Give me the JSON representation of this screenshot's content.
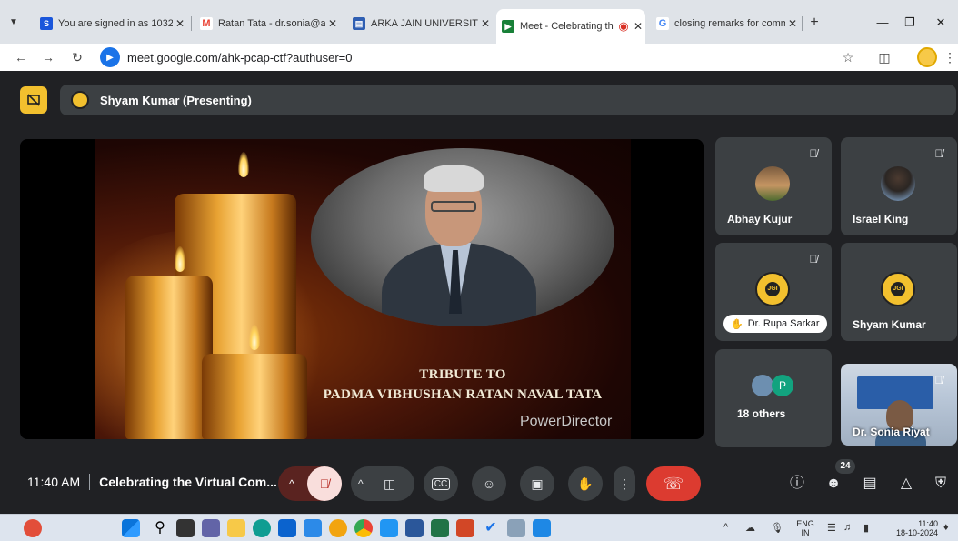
{
  "browser": {
    "tabs": [
      {
        "title": "You are signed in as 1032",
        "favicon": "S",
        "color": "#1a56db"
      },
      {
        "title": "Ratan Tata - dr.sonia@ar",
        "favicon": "M",
        "color": "#ea4335"
      },
      {
        "title": "ARKA JAIN UNIVERSITY -",
        "favicon": "▤",
        "color": "#2f5fb3"
      },
      {
        "title": "Meet - Celebrating th",
        "favicon": "▶",
        "color": "#188038"
      },
      {
        "title": "closing remarks for comm",
        "favicon": "G",
        "color": "#4285f4"
      }
    ],
    "url": "meet.google.com/ahk-pcap-ctf?authuser=0"
  },
  "meet": {
    "presenter_banner": "Shyam Kumar (Presenting)",
    "slide": {
      "line1": "TRIBUTE TO",
      "line2": "PADMA VIBHUSHAN RATAN NAVAL TATA",
      "watermark": "PowerDirector"
    },
    "participants": {
      "abhay": "Abhay Kujur",
      "israel": "Israel King",
      "rupa": "Dr. Rupa Sarkar",
      "shyam": "Shyam Kumar",
      "others": "18 others",
      "others_initial": "P",
      "sonia": "Dr. Sonia Riyat",
      "logo_text": "JGI"
    },
    "controls": {
      "time": "11:40 AM",
      "meeting_title": "Celebrating the Virtual Com...",
      "people_count": "24"
    }
  },
  "taskbar": {
    "lang": "ENG",
    "region": "IN",
    "time": "11:40",
    "date": "18-10-2024"
  },
  "colors": {
    "meet_bg": "#202124",
    "tile_bg": "#3c4043",
    "end_call": "#dc3b30",
    "accent_yellow": "#f2c02e"
  }
}
